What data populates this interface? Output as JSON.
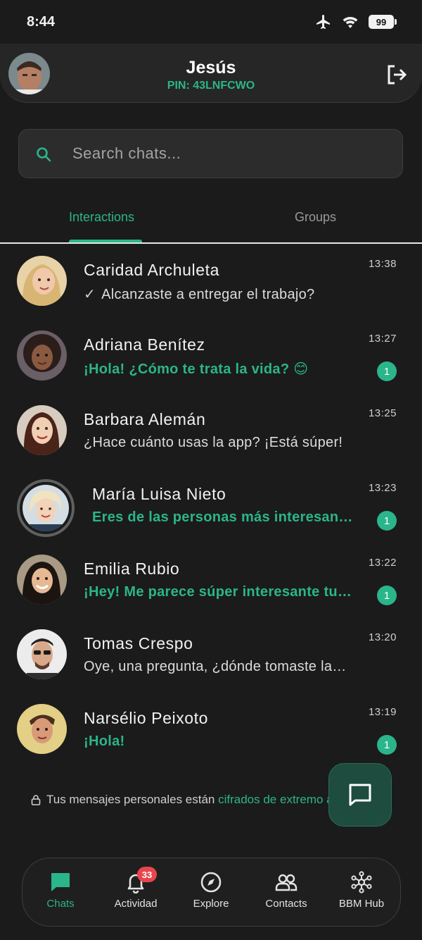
{
  "status_bar": {
    "time": "8:44",
    "battery": "99"
  },
  "header": {
    "name": "Jesús",
    "pin": "PIN: 43LNFCWO"
  },
  "search": {
    "placeholder": "Search chats..."
  },
  "tabs": [
    {
      "label": "Interactions",
      "active": true
    },
    {
      "label": "Groups",
      "active": false
    }
  ],
  "chats": [
    {
      "name": "Caridad Archuleta",
      "message": "Alcanzaste a entregar el trabajo?",
      "time": "13:38",
      "unread": null,
      "sent_check": true
    },
    {
      "name": "Adriana Benítez",
      "message": "¡Hola! ¿Cómo te trata la vida? 😊",
      "time": "13:27",
      "unread": "1"
    },
    {
      "name": "Barbara Alemán",
      "message": "¿Hace cuánto usas la app? ¡Está súper!",
      "time": "13:25",
      "unread": null
    },
    {
      "name": "María Luisa Nieto",
      "message": "Eres de las personas más interesantes",
      "time": "13:23",
      "unread": "1"
    },
    {
      "name": "Emilia Rubio",
      "message": "¡Hey! Me parece súper interesante tu comentario",
      "time": "13:22",
      "unread": "1"
    },
    {
      "name": "Tomas Crespo",
      "message": "Oye, una pregunta, ¿dónde tomaste la foto?",
      "time": "13:20",
      "unread": null
    },
    {
      "name": "Narsélio Peixoto",
      "message": "¡Hola!",
      "time": "13:19",
      "unread": "1"
    }
  ],
  "encryption": {
    "text": "Tus mensajes personales están ",
    "link": "cifrados de extremo a extremo"
  },
  "bottom_nav": [
    {
      "label": "Chats",
      "icon": "chat-bubble-icon",
      "active": true
    },
    {
      "label": "Actividad",
      "icon": "bell-icon",
      "badge": "33"
    },
    {
      "label": "Explore",
      "icon": "compass-icon"
    },
    {
      "label": "Contacts",
      "icon": "people-icon"
    },
    {
      "label": "BBM Hub",
      "icon": "hub-network-icon"
    }
  ],
  "colors": {
    "accent": "#2bb58a",
    "background": "#1b1b1b",
    "badge_red": "#e9454c"
  }
}
